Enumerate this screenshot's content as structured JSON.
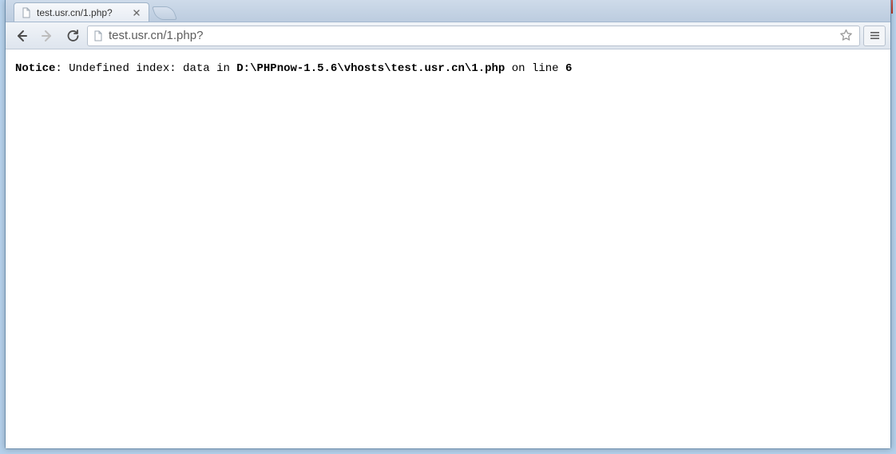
{
  "window_controls": {
    "user": "user-icon",
    "minimize": "minimize-icon",
    "maximize": "maximize-icon",
    "close": "close-icon"
  },
  "tab": {
    "title": "test.usr.cn/1.php?",
    "favicon": "file-icon"
  },
  "address_bar": {
    "url_display": "test.usr.cn/1.php?",
    "url_value": "test.usr.cn/1.php?"
  },
  "php_notice": {
    "label": "Notice",
    "colon_after_label": ": ",
    "message_prefix": "Undefined index: data in ",
    "path": "D:\\PHPnow-1.5.6\\vhosts\\test.usr.cn\\1.php",
    "on_line_text": " on line ",
    "line_number": "6"
  }
}
